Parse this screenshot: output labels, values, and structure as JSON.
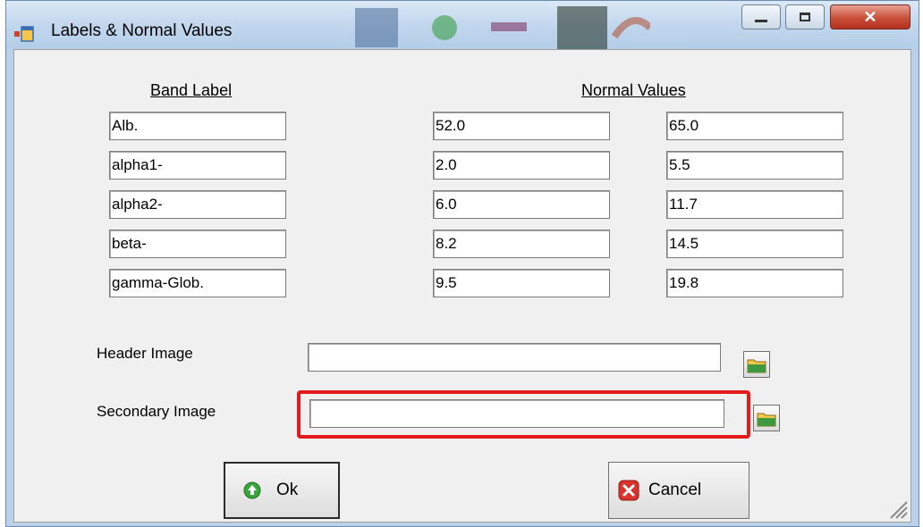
{
  "window": {
    "title": "Labels & Normal Values",
    "controls": [
      "minimize-icon",
      "maximize-icon",
      "close-icon"
    ]
  },
  "headers": {
    "band_label": "Band Label",
    "normal_values": "Normal Values"
  },
  "rows": [
    {
      "label": "Alb.",
      "low": "52.0",
      "high": "65.0"
    },
    {
      "label": "alpha1-",
      "low": "2.0",
      "high": "5.5"
    },
    {
      "label": "alpha2-",
      "low": "6.0",
      "high": "11.7"
    },
    {
      "label": "beta-",
      "low": "8.2",
      "high": "14.5"
    },
    {
      "label": "gamma-Glob.",
      "low": "9.5",
      "high": "19.8"
    }
  ],
  "header_image": {
    "label": "Header Image",
    "value": ""
  },
  "secondary_image": {
    "label": "Secondary Image",
    "value": ""
  },
  "buttons": {
    "ok": "Ok",
    "cancel": "Cancel"
  },
  "colors": {
    "highlight": "#e31b1b",
    "ok_icon": "#3aa53a",
    "cancel_icon": "#d9342b"
  }
}
